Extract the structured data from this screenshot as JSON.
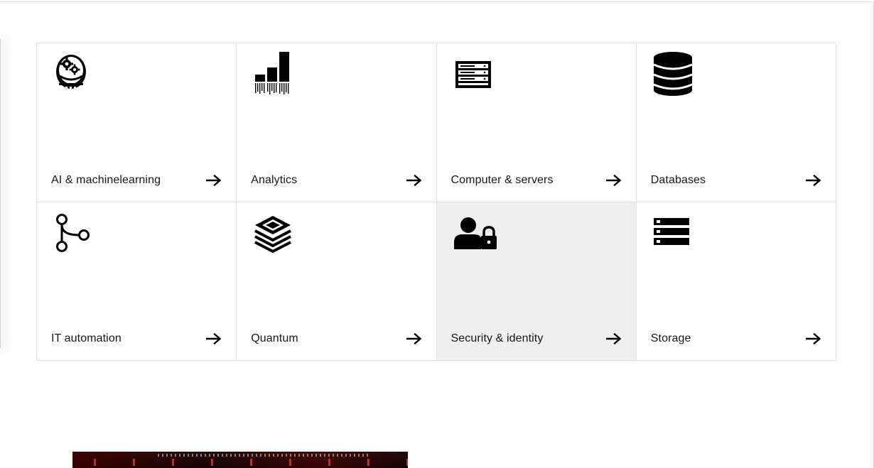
{
  "products": {
    "tiles": [
      {
        "label": "AI & machinelearning",
        "icon": "ai-brain-gear-icon"
      },
      {
        "label": "Analytics",
        "icon": "analytics-bars-icon"
      },
      {
        "label": "Computer & servers",
        "icon": "server-rack-icon"
      },
      {
        "label": "Databases",
        "icon": "database-icon"
      },
      {
        "label": "IT automation",
        "icon": "branch-icon"
      },
      {
        "label": "Quantum",
        "icon": "layers-icon"
      },
      {
        "label": "Security & identity",
        "icon": "user-lock-icon"
      },
      {
        "label": "Storage",
        "icon": "storage-list-icon"
      }
    ],
    "arrow_icon": "arrow-right-icon",
    "highlighted_tile": "Security & identity"
  },
  "colors": {
    "text": "#161616",
    "border": "#e0e0e0",
    "highlight_bg": "#efefef"
  }
}
